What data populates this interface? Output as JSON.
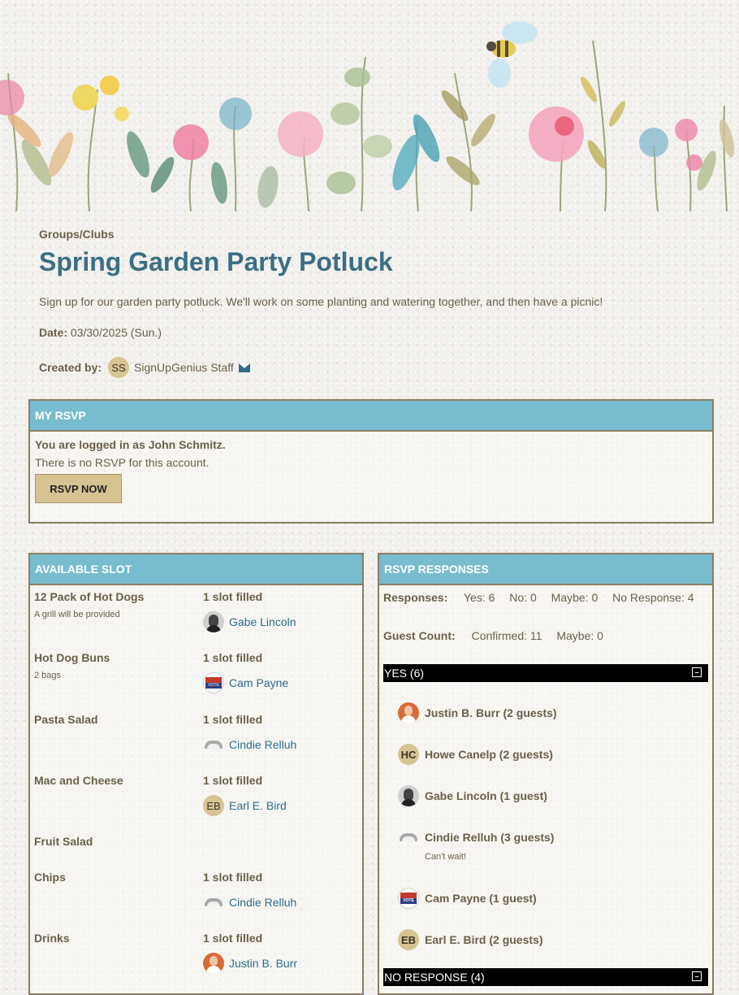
{
  "event": {
    "category": "Groups/Clubs",
    "title": "Spring Garden Party Potluck",
    "description": "Sign up for our garden party potluck. We'll work on some planting and watering together, and then have a picnic!",
    "date_label": "Date:",
    "date_value": "03/30/2025 (Sun.)",
    "created_by_label": "Created by:",
    "creator_initials": "SS",
    "creator_name": "SignUpGenius Staff"
  },
  "my_rsvp": {
    "header": "MY RSVP",
    "logged_in": "You are logged in as John Schmitz.",
    "no_rsvp": "There is no RSVP for this account.",
    "button": "RSVP NOW"
  },
  "slots": {
    "header": "AVAILABLE SLOT",
    "items": [
      {
        "name": "12 Pack of Hot Dogs",
        "note": "A grill will be provided",
        "status": "1 slot filled",
        "person": "Gabe Lincoln",
        "avatar": "lincoln-avatar"
      },
      {
        "name": "Hot Dog Buns",
        "note": "2 bags",
        "status": "1 slot filled",
        "person": "Cam Payne",
        "avatar": "vote-avatar"
      },
      {
        "name": "Pasta Salad",
        "note": "",
        "status": "1 slot filled",
        "person": "Cindie Relluh",
        "avatar": "cloud-avatar"
      },
      {
        "name": "Mac and Cheese",
        "note": "",
        "status": "1 slot filled",
        "person": "Earl E. Bird",
        "avatar": "EB"
      },
      {
        "name": "Fruit Salad",
        "note": "",
        "status": "",
        "person": "",
        "avatar": ""
      },
      {
        "name": "Chips",
        "note": "",
        "status": "1 slot filled",
        "person": "Cindie Relluh",
        "avatar": "cloud-avatar"
      },
      {
        "name": "Drinks",
        "note": "",
        "status": "1 slot filled",
        "person": "Justin B. Burr",
        "avatar": "photo-avatar"
      }
    ]
  },
  "responses": {
    "header": "RSVP RESPONSES",
    "responses_label": "Responses:",
    "yes": "Yes: 6",
    "no": "No: 0",
    "maybe": "Maybe: 0",
    "no_response": "No Response: 4",
    "guest_label": "Guest Count:",
    "confirmed": "Confirmed: 11",
    "guest_maybe": "Maybe: 0",
    "yes_group": "YES (6)",
    "no_response_group": "NO RESPONSE (4)",
    "yes_list": [
      {
        "name": "Justin B. Burr (2 guests)",
        "avatar": "photo-avatar",
        "note": ""
      },
      {
        "name": "Howe Canelp (2 guests)",
        "avatar": "HC",
        "note": ""
      },
      {
        "name": "Gabe Lincoln (1 guest)",
        "avatar": "lincoln-avatar",
        "note": ""
      },
      {
        "name": "Cindie Relluh (3 guests)",
        "avatar": "cloud-avatar",
        "note": "Can't wait!"
      },
      {
        "name": "Cam Payne (1 guest)",
        "avatar": "vote-avatar",
        "note": ""
      },
      {
        "name": "Earl E. Bird (2 guests)",
        "avatar": "EB",
        "note": ""
      }
    ]
  },
  "colors": {
    "accent": "#78bccf",
    "title": "#3b6f85",
    "link": "#2e6d8a",
    "button": "#d5c491"
  }
}
